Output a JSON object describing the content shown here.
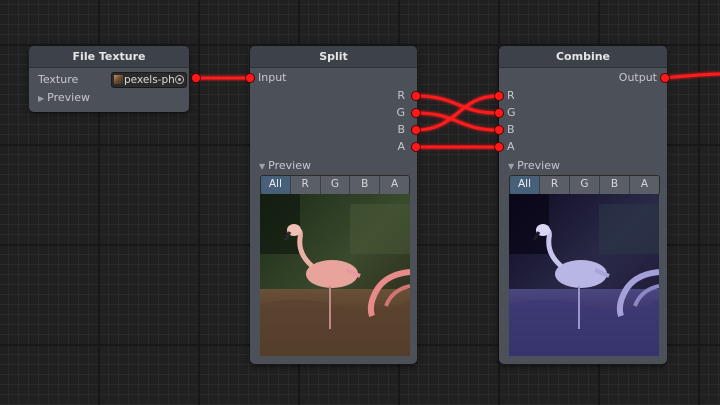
{
  "nodes": {
    "file_texture": {
      "title": "File Texture",
      "texture_label": "Texture",
      "texture_value": "pexels-ph",
      "preview_label": "Preview"
    },
    "split": {
      "title": "Split",
      "input_label": "Input",
      "outputs": [
        "R",
        "G",
        "B",
        "A"
      ],
      "preview_label": "Preview",
      "channels": [
        "All",
        "R",
        "G",
        "B",
        "A"
      ],
      "active_channel": "All"
    },
    "combine": {
      "title": "Combine",
      "inputs": [
        "R",
        "G",
        "B",
        "A"
      ],
      "output_label": "Output",
      "preview_label": "Preview",
      "channels": [
        "All",
        "R",
        "G",
        "B",
        "A"
      ],
      "active_channel": "All"
    }
  },
  "colors": {
    "canvas": "#202020",
    "node_body": "#4b5059",
    "node_header": "#3d4149",
    "wire": "#ff1a1a",
    "active_channel": "#46607a"
  },
  "icons": [
    "collapse-triangle-icon",
    "texture-thumbnail-icon",
    "object-picker-icon",
    "port-icon"
  ]
}
